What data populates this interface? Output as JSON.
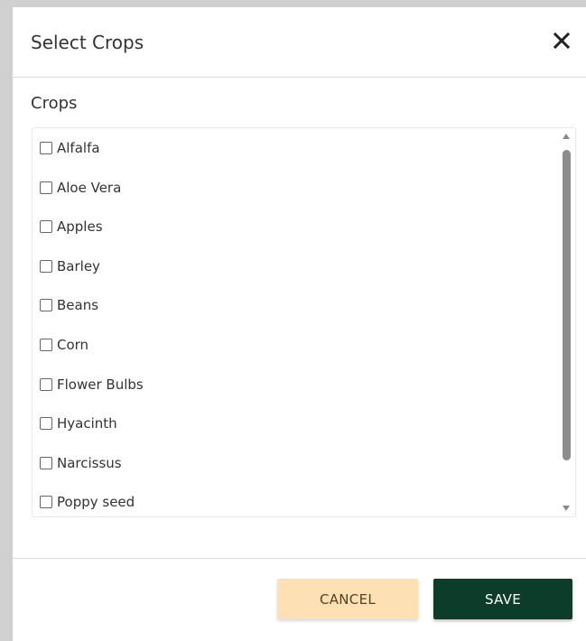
{
  "dialog": {
    "title": "Select Crops",
    "close_icon": "close-icon"
  },
  "crops": {
    "label": "Crops",
    "items": [
      {
        "label": "Alfalfa",
        "checked": false
      },
      {
        "label": "Aloe Vera",
        "checked": false
      },
      {
        "label": "Apples",
        "checked": false
      },
      {
        "label": "Barley",
        "checked": false
      },
      {
        "label": "Beans",
        "checked": false
      },
      {
        "label": "Corn",
        "checked": false
      },
      {
        "label": "Flower Bulbs",
        "checked": false
      },
      {
        "label": "Hyacinth",
        "checked": false
      },
      {
        "label": "Narcissus",
        "checked": false
      },
      {
        "label": "Poppy seed",
        "checked": false
      }
    ]
  },
  "footer": {
    "cancel_label": "CANCEL",
    "save_label": "SAVE"
  },
  "colors": {
    "cancel_bg": "#fde1b4",
    "save_bg": "#0b3d2a",
    "text": "#333333"
  }
}
